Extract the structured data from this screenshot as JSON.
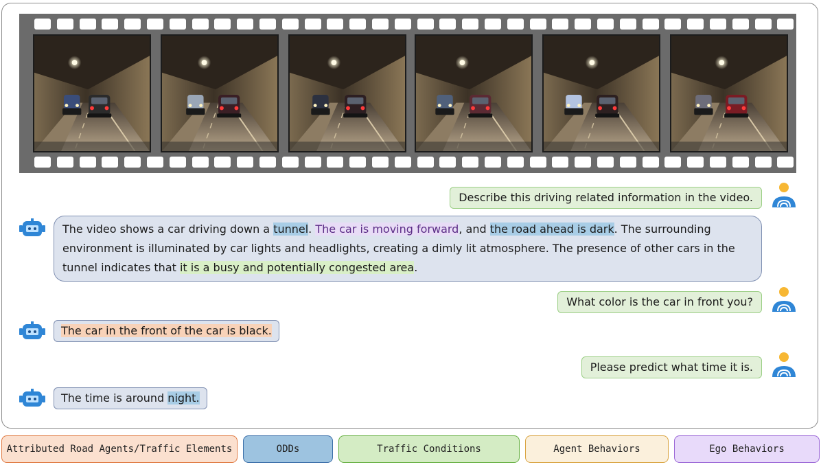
{
  "colors": {
    "user_bubble_bg": "#e2f0d9",
    "bot_bubble_bg": "#dde3ee",
    "odd_highlight": "#a8cde6",
    "ego_highlight": "#e8dcf6",
    "traffic_highlight": "#d9efc7",
    "agent_highlight": "#f8d2b8"
  },
  "conversation": {
    "q1": "Describe this driving related information in the video.",
    "a1": {
      "p1": "The video shows a car driving down a ",
      "h1": "tunnel",
      "p2": ". ",
      "h2": "The car is moving forward",
      "p3": ", and ",
      "h3": "the road ahead is dark",
      "p4": ". The surrounding environment is illuminated by car lights and headlights, creating a dimly lit atmosphere. The presence of other cars in the tunnel indicates that ",
      "h4": "it is a busy and potentially congested area",
      "p5": "."
    },
    "q2": "What color is the car in front you?",
    "a2": {
      "h1": "The car in the front of the car is black."
    },
    "q3": "Please predict what time it is.",
    "a3": {
      "p1": "The time is around ",
      "h1": "night."
    }
  },
  "legend": [
    {
      "label": "Attributed Road Agents/Traffic Elements",
      "bg": "#fbe0cf",
      "border": "#e07a42"
    },
    {
      "label": "ODDs",
      "bg": "#9dc3e0",
      "border": "#3a6ea8"
    },
    {
      "label": "Traffic Conditions",
      "bg": "#d4ecc4",
      "border": "#67b043"
    },
    {
      "label": "Agent Behaviors",
      "bg": "#fbf0dc",
      "border": "#d9a441"
    },
    {
      "label": "Ego Behaviors",
      "bg": "#e8dafa",
      "border": "#9a66d6"
    }
  ],
  "icons": {
    "user": "user-avatar-icon",
    "robot": "robot-icon"
  }
}
